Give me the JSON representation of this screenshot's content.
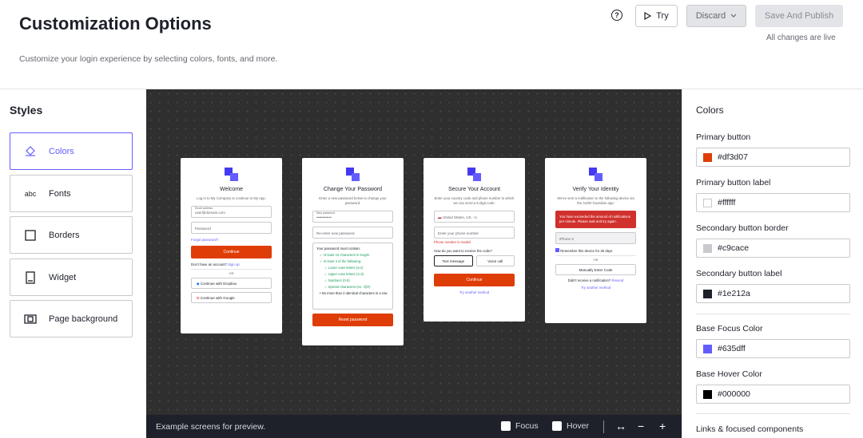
{
  "header": {
    "title": "Customization Options",
    "subtitle": "Customize your login experience by selecting colors, fonts, and more.",
    "try_label": "Try",
    "discard_label": "Discard",
    "publish_label": "Save And Publish",
    "live_note": "All changes are live"
  },
  "styles": {
    "heading": "Styles",
    "items": [
      {
        "label": "Colors",
        "icon": "paint-bucket-icon"
      },
      {
        "label": "Fonts",
        "icon": "abc-icon"
      },
      {
        "label": "Borders",
        "icon": "square-icon"
      },
      {
        "label": "Widget",
        "icon": "widget-icon"
      },
      {
        "label": "Page background",
        "icon": "background-icon"
      }
    ],
    "fonts_glyph": "abc"
  },
  "preview": {
    "welcome": {
      "title": "Welcome",
      "desc": "Log in to My Company to continue to My App.",
      "email_label": "Email address",
      "email_value": "user@domain.com",
      "password_placeholder": "Password",
      "forgot": "Forgot password?",
      "continue": "Continue",
      "signup_prefix": "Don't have an account?",
      "signup_link": "Sign up",
      "or": "OR",
      "dropbox": "Continue with Dropbox",
      "google": "Continue with Google"
    },
    "change_password": {
      "title": "Change Your Password",
      "desc": "Enter a new password below to change your password.",
      "new_label": "New password",
      "new_value": "••••••••••••",
      "reenter": "Re-enter new password",
      "rules_head": "Your password must contain:",
      "rule1": "✓ At least 10 characters in length",
      "rule2": "✓ At least 3 of the following:",
      "rule3": "✓ Lower case letters (a-z)",
      "rule4": "✓ Upper case letters (A-Z)",
      "rule5": "✓ Numbers (0-9)",
      "rule6": "✓ Special characters (ex. !@#)",
      "rule7": "• No more than 2 identical characters in a row",
      "reset": "Reset password"
    },
    "secure": {
      "title": "Secure Your Account",
      "desc": "Enter your country code and phone number to which we can send a 6-digit code:",
      "country": "United States, US, +1",
      "phone_placeholder": "Enter your phone number",
      "phone_error": "Phone number is invalid",
      "receive_q": "How do you want to receive the code?",
      "text_msg": "Text message",
      "voice": "Voice call",
      "continue": "Continue",
      "other": "Try another method"
    },
    "verify": {
      "title": "Verify Your Identity",
      "desc": "We've sent a notification to the following device via the Auth0 Guardian app:",
      "error": "You have exceeded the amount of notifications per minute. Please wait and try again.",
      "device": "iPhone X",
      "remember": "Remember this device for 30 days",
      "or": "OR",
      "manual": "Manually Enter Code",
      "resend_prefix": "Didn't receive a notification?",
      "resend_link": "Resend",
      "other": "Try another method"
    }
  },
  "bottom_bar": {
    "note": "Example screens for preview.",
    "focus_label": "Focus",
    "hover_label": "Hover",
    "fit_glyph": "↔",
    "zoom_out_glyph": "−",
    "zoom_in_glyph": "+"
  },
  "colors_panel": {
    "heading": "Colors",
    "fields": [
      {
        "label": "Primary button",
        "value": "#df3d07",
        "swatch": "#df3d07"
      },
      {
        "label": "Primary button label",
        "value": "#ffffff",
        "swatch": "#ffffff"
      },
      {
        "label": "Secondary button border",
        "value": "#c9cace",
        "swatch": "#c9cace"
      },
      {
        "label": "Secondary button label",
        "value": "#1e212a",
        "swatch": "#1e212a"
      },
      {
        "label": "Base Focus Color",
        "value": "#635dff",
        "swatch": "#635dff"
      },
      {
        "label": "Base Hover Color",
        "value": "#000000",
        "swatch": "#000000"
      }
    ],
    "next_heading": "Links & focused components"
  }
}
